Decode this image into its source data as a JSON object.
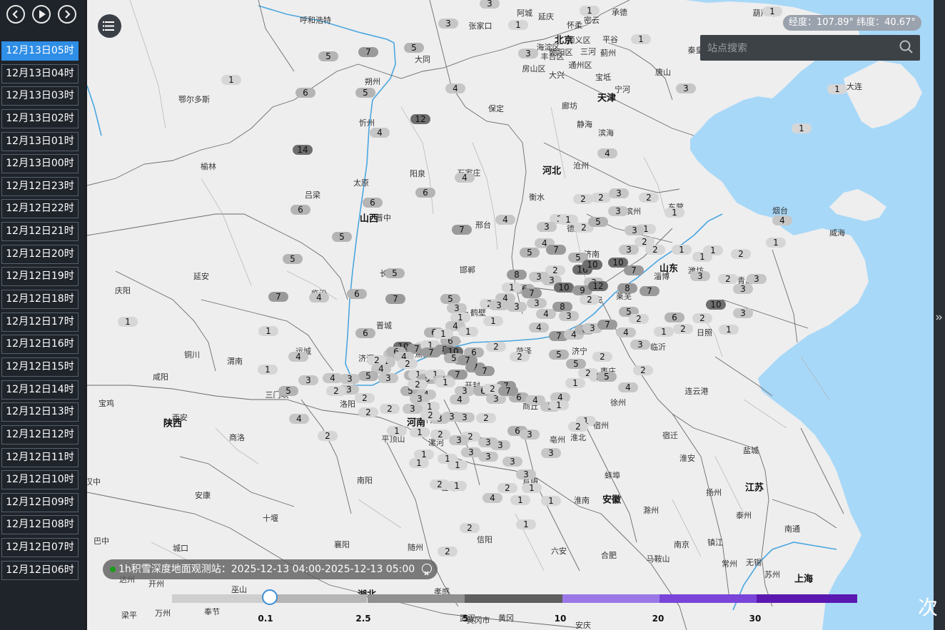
{
  "timeline": {
    "items": [
      "12月13日05时",
      "12月13日04时",
      "12月13日03时",
      "12月13日02时",
      "12月13日01时",
      "12月13日00时",
      "12月12日23时",
      "12月12日22时",
      "12月12日21时",
      "12月12日20时",
      "12月12日19时",
      "12月12日18时",
      "12月12日17时",
      "12月12日16时",
      "12月12日15时",
      "12月12日14时",
      "12月12日13时",
      "12月12日12时",
      "12月12日11时",
      "12月12日10时",
      "12月12日09时",
      "12月12日08时",
      "12月12日07时",
      "12月12日06时"
    ],
    "active_index": 0,
    "buttons": {
      "prev": "chevron-left-icon",
      "play": "play-icon",
      "next": "chevron-right-icon"
    }
  },
  "map": {
    "coord_readout": "经度：107.89°  纬度：40.67°",
    "search_placeholder": "站点搜索",
    "province_labels": [
      "北京",
      "天津",
      "河北",
      "山西",
      "山东",
      "陕西",
      "河南",
      "安徽",
      "江苏",
      "湖北",
      "上海"
    ],
    "city_labels": [
      "呼和浩特",
      "鄂尔多斯",
      "榆林",
      "延安",
      "庆阳",
      "铜川",
      "咸阳",
      "宝鸡",
      "渭南",
      "西安",
      "商洛",
      "安康",
      "汉中",
      "巴中",
      "达州",
      "城口",
      "十堰",
      "巫山",
      "奉节",
      "万州",
      "梁平",
      "开州",
      "襄阳",
      "随州",
      "孝感",
      "信阳",
      "南阳",
      "驻马店",
      "平顶山",
      "洛阳",
      "三门峡",
      "运城",
      "临汾",
      "吕梁",
      "太原",
      "忻州",
      "朔州",
      "大同",
      "阳泉",
      "晋中",
      "长治",
      "晋城",
      "济源",
      "郑州",
      "开封",
      "商丘",
      "周口",
      "漯河",
      "许昌",
      "阜阳",
      "亳州",
      "宿州",
      "淮北",
      "淮南",
      "蚌埠",
      "合肥",
      "六安",
      "黄冈",
      "武汉",
      "徐州",
      "宿迁",
      "连云港",
      "淮安",
      "盐城",
      "扬州",
      "泰州",
      "南通",
      "镇江",
      "南京",
      "常州",
      "无锡",
      "苏州",
      "马鞍山",
      "滁州",
      "枣庄",
      "临沂",
      "日照",
      "济宁",
      "泰安",
      "莱芜",
      "济南",
      "德州",
      "滨州",
      "东营",
      "潍坊",
      "青岛",
      "烟台",
      "威海",
      "淄博",
      "聊城",
      "菏泽",
      "新乡",
      "安阳",
      "鹤壁",
      "焦作",
      "邯郸",
      "邢台",
      "衡水",
      "石家庄",
      "保定",
      "沧州",
      "廊坊",
      "唐山",
      "秦皇岛",
      "葫芦岛",
      "大连",
      "张家口",
      "承德",
      "顺义区",
      "房山区",
      "通州区",
      "静海",
      "滨海",
      "宁河",
      "宝坻",
      "丰台区",
      "朝阳区",
      "海淀区",
      "怀柔",
      "密云",
      "平谷",
      "延庆",
      "三河",
      "蓟州",
      "大兴",
      "黄冈市",
      "安庆",
      "阿城"
    ],
    "stations": [
      [
        "3",
        686,
        5
      ],
      [
        "1",
        726,
        35
      ],
      [
        "1",
        826,
        15
      ],
      [
        "3",
        628,
        33
      ],
      [
        "3",
        740,
        75
      ],
      [
        "1",
        898,
        55
      ],
      [
        "5",
        460,
        79
      ],
      [
        "7",
        516,
        73
      ],
      [
        "5",
        580,
        67
      ],
      [
        "1",
        324,
        112
      ],
      [
        "6",
        428,
        130
      ],
      [
        "5",
        512,
        130
      ],
      [
        "4",
        638,
        124
      ],
      [
        "3",
        961,
        124
      ],
      [
        "1",
        1082,
        16
      ],
      [
        "1",
        1173,
        125
      ],
      [
        "1",
        1123,
        180
      ],
      [
        "12",
        589,
        167
      ],
      [
        "4",
        532,
        186
      ],
      [
        "14",
        424,
        210
      ],
      [
        "4",
        651,
        249
      ],
      [
        "4",
        851,
        215
      ],
      [
        "6",
        522,
        284
      ],
      [
        "6",
        596,
        270
      ],
      [
        "6",
        421,
        294
      ],
      [
        "5",
        479,
        332
      ],
      [
        "7",
        647,
        322
      ],
      [
        "4",
        708,
        308
      ],
      [
        "2",
        817,
        279
      ],
      [
        "2",
        842,
        277
      ],
      [
        "3",
        867,
        271
      ],
      [
        "2",
        909,
        277
      ],
      [
        "3",
        866,
        296
      ],
      [
        "1",
        945,
        298
      ],
      [
        "4",
        1096,
        309
      ],
      [
        "5",
        410,
        363
      ],
      [
        "7",
        390,
        416
      ],
      [
        "4",
        447,
        417
      ],
      [
        "6",
        500,
        412
      ],
      [
        "7",
        554,
        419
      ],
      [
        "5",
        553,
        383
      ],
      [
        "1",
        179,
        451
      ],
      [
        "1",
        376,
        464
      ],
      [
        "1",
        375,
        518
      ],
      [
        "4",
        418,
        500
      ],
      [
        "5",
        404,
        548
      ],
      [
        "4",
        419,
        587
      ],
      [
        "2",
        459,
        611
      ],
      [
        "6",
        512,
        467
      ],
      [
        "5",
        631,
        419
      ],
      [
        "2",
        784,
        307
      ],
      [
        "3",
        766,
        318
      ],
      [
        "2",
        818,
        319
      ],
      [
        "5",
        838,
        311
      ],
      [
        "1",
        796,
        308
      ],
      [
        "4",
        763,
        341
      ],
      [
        "5",
        742,
        354
      ],
      [
        "7",
        779,
        350
      ],
      [
        "5",
        810,
        361
      ],
      [
        "10",
        866,
        368
      ],
      [
        "16",
        816,
        378
      ],
      [
        "10",
        830,
        371
      ],
      [
        "7",
        888,
        379
      ],
      [
        "3",
        881,
        350
      ],
      [
        "2",
        918,
        350
      ],
      [
        "1",
        905,
        321
      ],
      [
        "2",
        903,
        339
      ],
      [
        "3",
        889,
        323
      ],
      [
        "1",
        955,
        350
      ],
      [
        "1",
        984,
        360
      ],
      [
        "1",
        999,
        351
      ],
      [
        "2",
        1038,
        356
      ],
      [
        "1",
        1087,
        340
      ],
      [
        "8",
        724,
        385
      ],
      [
        "2",
        778,
        379
      ],
      [
        "3",
        773,
        393
      ],
      [
        "3",
        832,
        396
      ],
      [
        "10",
        790,
        403
      ],
      [
        "9",
        816,
        407
      ],
      [
        "12",
        838,
        401
      ],
      [
        "8",
        879,
        404
      ],
      [
        "7",
        910,
        408
      ],
      [
        "6",
        735,
        405
      ],
      [
        "7",
        745,
        411
      ],
      [
        "3",
        755,
        388
      ],
      [
        "1",
        717,
        403
      ],
      [
        "4",
        708,
        418
      ],
      [
        "3",
        752,
        425
      ],
      [
        "2",
        826,
        420
      ],
      [
        "3",
        724,
        430
      ],
      [
        "4",
        765,
        440
      ],
      [
        "8",
        788,
        430
      ],
      [
        "3",
        797,
        443
      ],
      [
        "5",
        881,
        437
      ],
      [
        "2",
        895,
        447
      ],
      [
        "6",
        945,
        445
      ],
      [
        "2",
        984,
        446
      ],
      [
        "2",
        1020,
        391
      ],
      [
        "3",
        1041,
        405
      ],
      [
        "3",
        1060,
        391
      ],
      [
        "10",
        1003,
        427
      ],
      [
        "3",
        1041,
        439
      ],
      [
        "3",
        981,
        387
      ],
      [
        "4",
        755,
        459
      ],
      [
        "7",
        783,
        471
      ],
      [
        "4",
        804,
        469
      ],
      [
        "6",
        819,
        462
      ],
      [
        "3",
        830,
        460
      ],
      [
        "7",
        851,
        455
      ],
      [
        "4",
        877,
        466
      ],
      [
        "3",
        897,
        483
      ],
      [
        "1",
        930,
        465
      ],
      [
        "2",
        957,
        461
      ],
      [
        "1",
        1021,
        462
      ],
      [
        "2",
        686,
        426
      ],
      [
        "3",
        699,
        428
      ],
      [
        "1",
        691,
        450
      ],
      [
        "3",
        640,
        432
      ],
      [
        "1",
        645,
        445
      ],
      [
        "4",
        638,
        457
      ],
      [
        "1",
        656,
        465
      ],
      [
        "6",
        608,
        466
      ],
      [
        "6",
        631,
        478
      ],
      [
        "2",
        595,
        486
      ],
      [
        "1",
        621,
        468
      ],
      [
        "10",
        565,
        486
      ],
      [
        "7",
        584,
        489
      ],
      [
        "1",
        603,
        484
      ],
      [
        "8",
        623,
        490
      ],
      [
        "7",
        604,
        494
      ],
      [
        "9",
        649,
        504
      ],
      [
        "10",
        635,
        493
      ],
      [
        "6",
        664,
        494
      ],
      [
        "7",
        666,
        515
      ],
      [
        "2",
        695,
        486
      ],
      [
        "2",
        728,
        500
      ],
      [
        "5",
        783,
        497
      ],
      [
        "2",
        844,
        500
      ],
      [
        "5",
        807,
        510
      ],
      [
        "2",
        824,
        523
      ],
      [
        "2",
        839,
        528
      ],
      [
        "5",
        850,
        528
      ],
      [
        "4",
        880,
        543
      ],
      [
        "2",
        901,
        519
      ],
      [
        "1",
        806,
        537
      ],
      [
        "4",
        551,
        497
      ],
      [
        "6",
        555,
        493
      ],
      [
        "4",
        566,
        500
      ],
      [
        "4",
        540,
        508
      ],
      [
        "2",
        571,
        510
      ],
      [
        "2",
        528,
        505
      ],
      [
        "4",
        534,
        517
      ],
      [
        "3",
        544,
        530
      ],
      [
        "5",
        516,
        527
      ],
      [
        "3",
        490,
        531
      ],
      [
        "4",
        466,
        530
      ],
      [
        "3",
        432,
        533
      ],
      [
        "6",
        580,
        526
      ],
      [
        "1",
        586,
        525
      ],
      [
        "5",
        599,
        531
      ],
      [
        "1",
        610,
        525
      ],
      [
        "7",
        641,
        525
      ],
      [
        "4",
        621,
        533
      ],
      [
        "7",
        679,
        520
      ],
      [
        "1",
        624,
        536
      ],
      [
        "5",
        575,
        548
      ],
      [
        "2",
        585,
        539
      ],
      [
        "4",
        597,
        553
      ],
      [
        "2",
        511,
        558
      ],
      [
        "3",
        489,
        546
      ],
      [
        "2",
        471,
        548
      ],
      [
        "4",
        644,
        560
      ],
      [
        "3",
        651,
        548
      ],
      [
        "6",
        677,
        548
      ],
      [
        "7",
        709,
        541
      ],
      [
        "2",
        690,
        545
      ],
      [
        "3",
        695,
        559
      ],
      [
        "6",
        727,
        557
      ],
      [
        "1",
        707,
        549
      ],
      [
        "4",
        750,
        561
      ],
      [
        "7",
        712,
        548
      ],
      [
        "4",
        785,
        557
      ],
      [
        "3",
        771,
        570
      ],
      [
        "1",
        783,
        568
      ],
      [
        "3",
        588,
        559
      ],
      [
        "1",
        602,
        570
      ],
      [
        "3",
        578,
        573
      ],
      [
        "3",
        616,
        587
      ],
      [
        "2",
        603,
        582
      ],
      [
        "3",
        633,
        584
      ],
      [
        "3",
        651,
        585
      ],
      [
        "2",
        681,
        586
      ],
      [
        "2",
        546,
        573
      ],
      [
        "2",
        516,
        578
      ],
      [
        "1",
        588,
        606
      ],
      [
        "1",
        556,
        604
      ],
      [
        "2",
        617,
        609
      ],
      [
        "2",
        659,
        612
      ],
      [
        "3",
        643,
        617
      ],
      [
        "3",
        684,
        620
      ],
      [
        "3",
        701,
        624
      ],
      [
        "6",
        725,
        604
      ],
      [
        "3",
        742,
        609
      ],
      [
        "1",
        821,
        590
      ],
      [
        "2",
        810,
        598
      ],
      [
        "3",
        660,
        634
      ],
      [
        "3",
        684,
        640
      ],
      [
        "3",
        718,
        647
      ],
      [
        "1",
        594,
        637
      ],
      [
        "1",
        587,
        649
      ],
      [
        "1",
        627,
        643
      ],
      [
        "1",
        641,
        652
      ],
      [
        "3",
        772,
        635
      ],
      [
        "3",
        737,
        665
      ],
      [
        "1",
        745,
        684
      ],
      [
        "2",
        616,
        679
      ],
      [
        "1",
        640,
        681
      ],
      [
        "4",
        690,
        698
      ],
      [
        "2",
        711,
        684
      ],
      [
        "1",
        729,
        701
      ],
      [
        "1",
        772,
        702
      ],
      [
        "2",
        658,
        740
      ],
      [
        "1",
        737,
        735
      ],
      [
        "2",
        627,
        773
      ],
      [
        "5",
        636,
        502
      ],
      [
        "7",
        655,
        505
      ]
    ]
  },
  "legend": {
    "title": "1h积雪深度地面观测站：2025-12-13 04:00-2025-12-13 05:00",
    "ticks": [
      "0.1",
      "2.5",
      "5",
      "10",
      "20",
      "30"
    ],
    "colors": [
      "#cfcfcf",
      "#b5b5b5",
      "#8f8f8f",
      "#5e5e5e",
      "#9a77e6",
      "#7a44d8",
      "#5a18b0",
      "#c9c9c9"
    ],
    "slider_value": 0.1,
    "corner_char": "次"
  }
}
